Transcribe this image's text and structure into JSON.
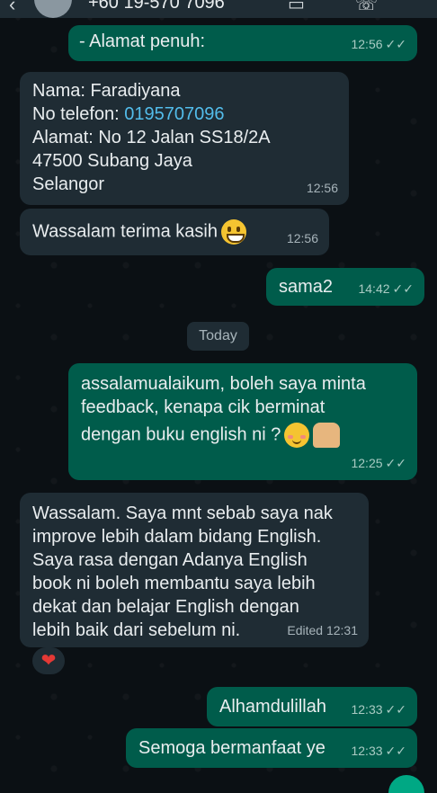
{
  "header": {
    "contact_number": "+60 19-570 7096"
  },
  "messages": [
    {
      "dir": "out",
      "lines": [
        "- Alamat penuh:"
      ],
      "time": "12:56"
    },
    {
      "dir": "in",
      "lines": [
        "Nama: Faradiyana",
        "No telefon: ",
        "Alamat: No 12 Jalan SS18/2A",
        "47500 Subang Jaya",
        "Selangor"
      ],
      "phone_link": "0195707096",
      "time": "12:56"
    },
    {
      "dir": "in",
      "lines": [
        "Wassalam terima kasih"
      ],
      "time": "12:56"
    },
    {
      "dir": "out",
      "lines": [
        "sama2"
      ],
      "time": "14:42"
    },
    {
      "dir": "out",
      "lines": [
        "assalamualaikum, boleh saya minta",
        "feedback, kenapa cik berminat",
        "dengan buku english ni ?"
      ],
      "time": "12:25"
    },
    {
      "dir": "in",
      "lines": [
        "Wassalam. Saya mnt sebab saya nak",
        "improve lebih dalam bidang English.",
        "Saya rasa dengan Adanya English",
        "book ni boleh membantu saya lebih",
        "dekat dan belajar English dengan",
        "lebih baik dari sebelum ni."
      ],
      "time": "Edited 12:31"
    },
    {
      "dir": "out",
      "lines": [
        "Alhamdulillah"
      ],
      "time": "12:33"
    },
    {
      "dir": "out",
      "lines": [
        "Semoga bermanfaat ye"
      ],
      "time": "12:33"
    }
  ],
  "date_divider": "Today",
  "read_ticks": "✓✓",
  "reaction": "❤",
  "icons": [
    "back-arrow-icon",
    "avatar",
    "video-call-icon",
    "phone-icon",
    "grinning-face-icon",
    "smiling-blush-icon",
    "raised-hands-icon",
    "heart-reaction-icon"
  ],
  "colors": {
    "background": "#0b1014",
    "incoming_bubble": "#1f2c34",
    "outgoing_bubble": "#005c4b",
    "link": "#53bdeb",
    "meta_text": "#a7b4ba"
  }
}
